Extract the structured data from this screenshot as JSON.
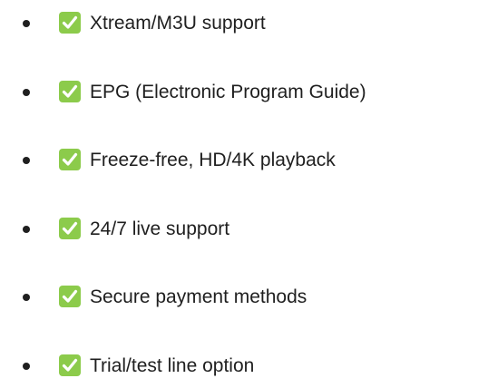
{
  "features": {
    "items": [
      {
        "label": "Xtream/M3U support",
        "icon": "check-mark-button-icon"
      },
      {
        "label": "EPG (Electronic Program Guide)",
        "icon": "check-mark-button-icon"
      },
      {
        "label": "Freeze-free, HD/4K playback",
        "icon": "check-mark-button-icon"
      },
      {
        "label": "24/7 live support",
        "icon": "check-mark-button-icon"
      },
      {
        "label": "Secure payment methods",
        "icon": "check-mark-button-icon"
      },
      {
        "label": "Trial/test line option",
        "icon": "check-mark-button-icon"
      }
    ],
    "colors": {
      "check_bg": "#8ccb4b",
      "check_mark": "#ffffff",
      "text": "#1f1f1f",
      "bullet": "#1f1f1f"
    }
  }
}
